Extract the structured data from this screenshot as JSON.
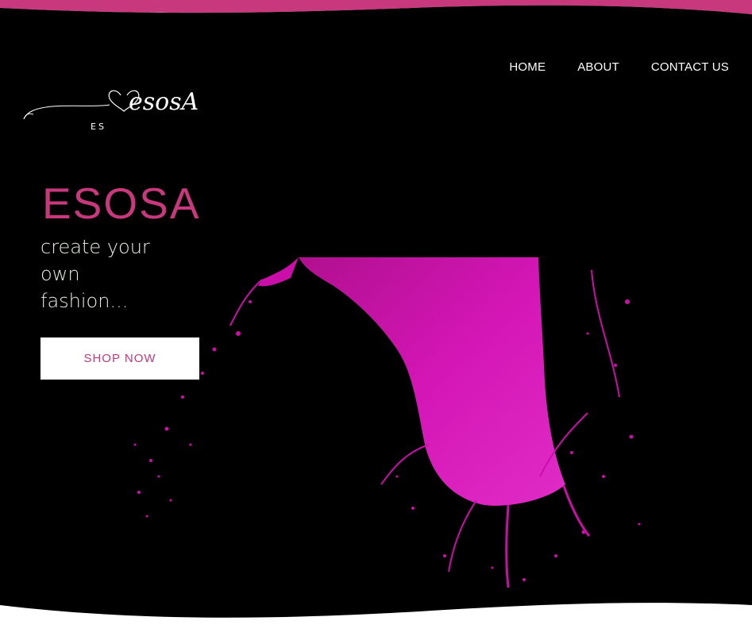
{
  "colors": {
    "background": "#000000",
    "accent": "#c7387c",
    "splash": "#d112b0",
    "tagline": "#e6efe3",
    "button_bg": "#ffffff",
    "button_text": "#c3387a"
  },
  "nav": {
    "items": [
      {
        "label": "HOME"
      },
      {
        "label": "ABOUT"
      },
      {
        "label": "CONTACT US"
      }
    ]
  },
  "logo": {
    "script_text": "esosA",
    "small_text": "ES"
  },
  "hero": {
    "title": "ESOSA",
    "tagline_lines": [
      "create your",
      "own",
      "fashion..."
    ],
    "button_label": "SHOP NOW",
    "image": "pink-paint-splash"
  }
}
